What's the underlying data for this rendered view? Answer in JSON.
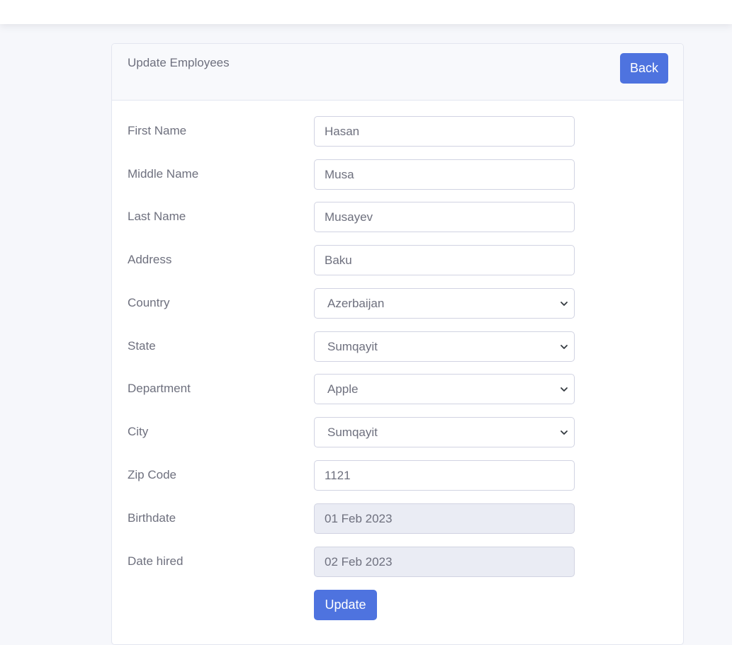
{
  "page": {
    "title": "Update Employees",
    "back_label": "Back",
    "update_label": "Update"
  },
  "form": {
    "first_name": {
      "label": "First Name",
      "value": "Hasan"
    },
    "middle_name": {
      "label": "Middle Name",
      "value": "Musa"
    },
    "last_name": {
      "label": "Last Name",
      "value": "Musayev"
    },
    "address": {
      "label": "Address",
      "value": "Baku"
    },
    "country": {
      "label": "Country",
      "value": "Azerbaijan"
    },
    "state": {
      "label": "State",
      "value": "Sumqayit"
    },
    "department": {
      "label": "Department",
      "value": "Apple"
    },
    "city": {
      "label": "City",
      "value": "Sumqayit"
    },
    "zip_code": {
      "label": "Zip Code",
      "value": "1121"
    },
    "birthdate": {
      "label": "Birthdate",
      "value": "01 Feb 2023"
    },
    "date_hired": {
      "label": "Date hired",
      "value": "02 Feb 2023"
    }
  },
  "colors": {
    "accent": "#4e73df",
    "background": "#f6f7fb",
    "readonly_field": "#eaecf4"
  },
  "icons": {
    "select_arrow": "chevron-down-icon"
  }
}
